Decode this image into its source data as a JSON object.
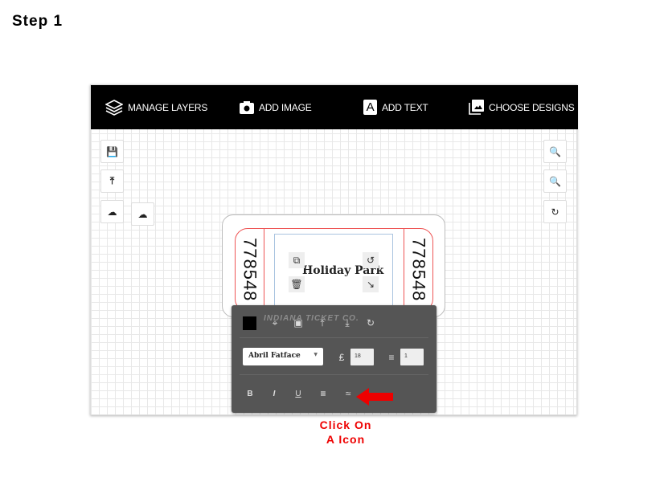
{
  "step_title": "Step 1",
  "nav": {
    "manage_layers": "MANAGE LAYERS",
    "add_image": "ADD IMAGE",
    "add_text": "ADD TEXT",
    "choose_designs": "CHOOSE DESIGNS"
  },
  "ticket": {
    "number": "778548",
    "title": "Holiday Park",
    "footer": "INDIANA TICKET CO."
  },
  "text_toolbar": {
    "font": "Abril Fatface",
    "font_size": "18",
    "line_height": "1",
    "color": "#000000"
  },
  "hint": {
    "line1": "Click On",
    "line2": "A Icon",
    "color": "#ee0000"
  }
}
